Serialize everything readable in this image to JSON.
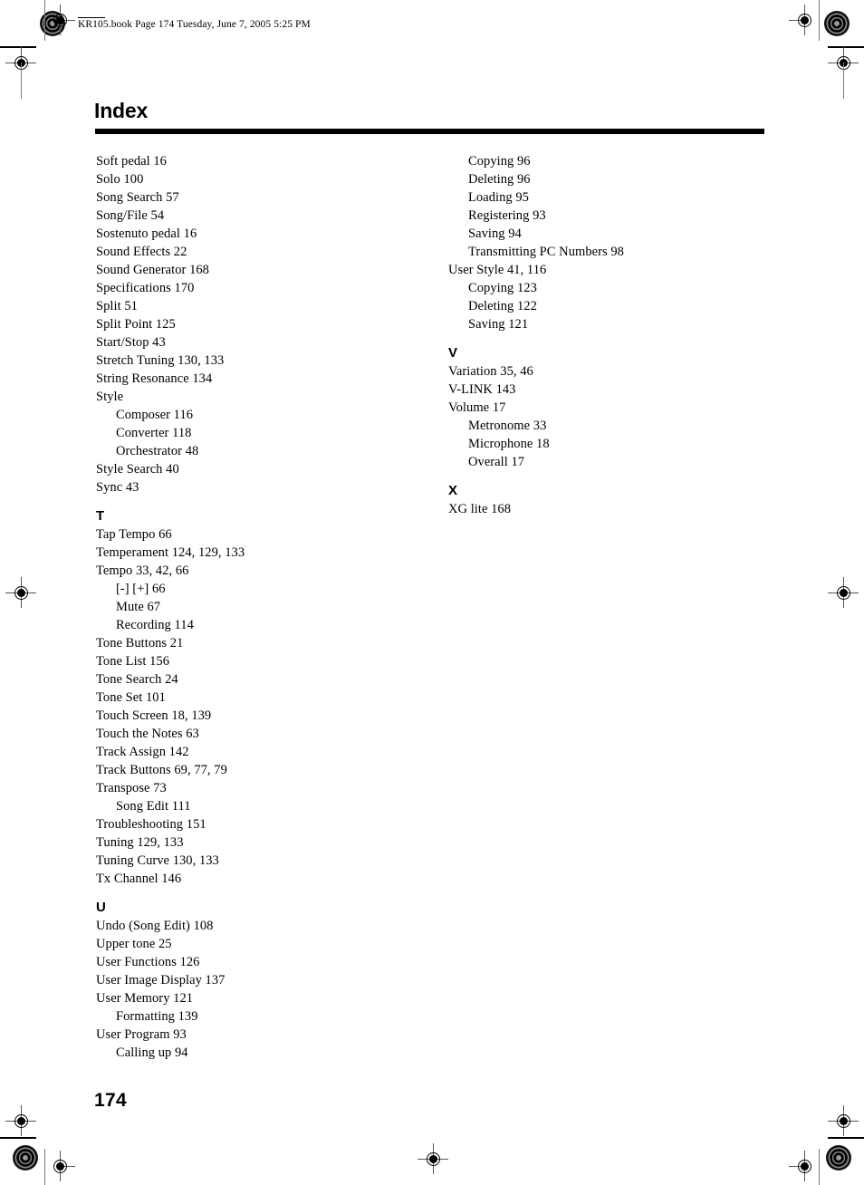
{
  "running_header": {
    "text": "KR105.book  Page 174  Tuesday, June 7, 2005  5:25 PM"
  },
  "title": "Index",
  "folio": "174",
  "columns": [
    {
      "name": "left-column",
      "blocks": [
        {
          "letter": "",
          "entries": [
            {
              "text": "Soft pedal 16",
              "level": 0
            },
            {
              "text": "Solo 100",
              "level": 0
            },
            {
              "text": "Song Search 57",
              "level": 0
            },
            {
              "text": "Song/File 54",
              "level": 0
            },
            {
              "text": "Sostenuto pedal 16",
              "level": 0
            },
            {
              "text": "Sound Effects 22",
              "level": 0
            },
            {
              "text": "Sound Generator 168",
              "level": 0
            },
            {
              "text": "Specifications 170",
              "level": 0
            },
            {
              "text": "Split 51",
              "level": 0
            },
            {
              "text": "Split Point 125",
              "level": 0
            },
            {
              "text": "Start/Stop 43",
              "level": 0
            },
            {
              "text": "Stretch Tuning 130, 133",
              "level": 0
            },
            {
              "text": "String Resonance 134",
              "level": 0
            },
            {
              "text": "Style",
              "level": 0
            },
            {
              "text": "Composer 116",
              "level": 1
            },
            {
              "text": "Converter 118",
              "level": 1
            },
            {
              "text": "Orchestrator 48",
              "level": 1
            },
            {
              "text": "Style Search 40",
              "level": 0
            },
            {
              "text": "Sync 43",
              "level": 0
            }
          ]
        },
        {
          "letter": "T",
          "entries": [
            {
              "text": "Tap Tempo 66",
              "level": 0
            },
            {
              "text": "Temperament 124, 129, 133",
              "level": 0
            },
            {
              "text": "Tempo 33, 42, 66",
              "level": 0
            },
            {
              "text": "[-] [+] 66",
              "level": 1
            },
            {
              "text": "Mute 67",
              "level": 1
            },
            {
              "text": "Recording 114",
              "level": 1
            },
            {
              "text": "Tone Buttons 21",
              "level": 0
            },
            {
              "text": "Tone List 156",
              "level": 0
            },
            {
              "text": "Tone Search 24",
              "level": 0
            },
            {
              "text": "Tone Set 101",
              "level": 0
            },
            {
              "text": "Touch Screen 18, 139",
              "level": 0
            },
            {
              "text": "Touch the Notes 63",
              "level": 0
            },
            {
              "text": "Track Assign 142",
              "level": 0
            },
            {
              "text": "Track Buttons 69, 77, 79",
              "level": 0
            },
            {
              "text": "Transpose 73",
              "level": 0
            },
            {
              "text": "Song Edit 111",
              "level": 1
            },
            {
              "text": "Troubleshooting 151",
              "level": 0
            },
            {
              "text": "Tuning 129, 133",
              "level": 0
            },
            {
              "text": "Tuning Curve 130, 133",
              "level": 0
            },
            {
              "text": "Tx Channel 146",
              "level": 0
            }
          ]
        },
        {
          "letter": "U",
          "entries": [
            {
              "text": "Undo (Song Edit) 108",
              "level": 0
            },
            {
              "text": "Upper tone 25",
              "level": 0
            },
            {
              "text": "User Functions 126",
              "level": 0
            },
            {
              "text": "User Image Display 137",
              "level": 0
            },
            {
              "text": "User Memory 121",
              "level": 0
            },
            {
              "text": "Formatting 139",
              "level": 1
            },
            {
              "text": "User Program 93",
              "level": 0
            },
            {
              "text": "Calling up 94",
              "level": 1
            }
          ]
        }
      ]
    },
    {
      "name": "right-column",
      "blocks": [
        {
          "letter": "",
          "entries": [
            {
              "text": "Copying 96",
              "level": 1
            },
            {
              "text": "Deleting 96",
              "level": 1
            },
            {
              "text": "Loading 95",
              "level": 1
            },
            {
              "text": "Registering 93",
              "level": 1
            },
            {
              "text": "Saving 94",
              "level": 1
            },
            {
              "text": "Transmitting PC Numbers 98",
              "level": 1
            },
            {
              "text": "User Style 41, 116",
              "level": 0
            },
            {
              "text": "Copying 123",
              "level": 1
            },
            {
              "text": "Deleting 122",
              "level": 1
            },
            {
              "text": "Saving 121",
              "level": 1
            }
          ]
        },
        {
          "letter": "V",
          "entries": [
            {
              "text": "Variation 35, 46",
              "level": 0
            },
            {
              "text": "V-LINK 143",
              "level": 0
            },
            {
              "text": "Volume 17",
              "level": 0
            },
            {
              "text": "Metronome 33",
              "level": 1
            },
            {
              "text": "Microphone 18",
              "level": 1
            },
            {
              "text": "Overall 17",
              "level": 1
            }
          ]
        },
        {
          "letter": "X",
          "entries": [
            {
              "text": "XG lite 168",
              "level": 0
            }
          ]
        }
      ]
    }
  ]
}
